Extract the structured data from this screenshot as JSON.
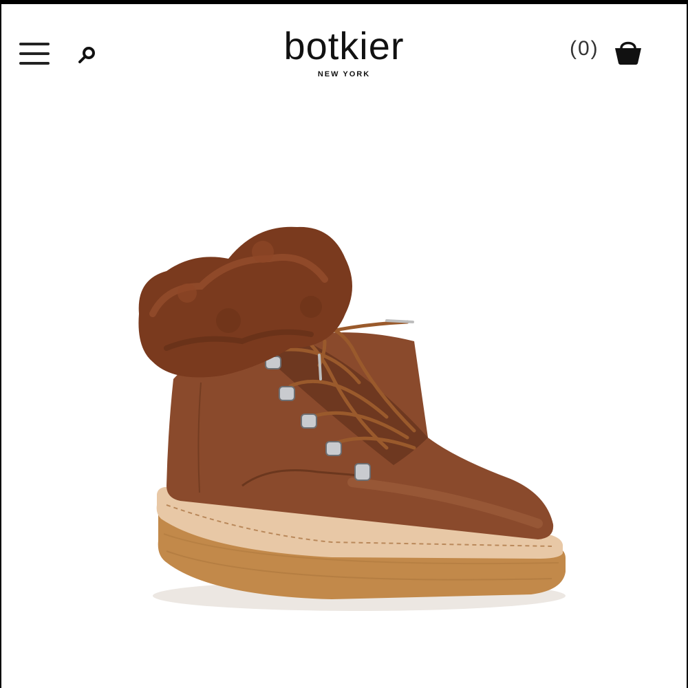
{
  "header": {
    "menu_icon": "hamburger-menu-icon",
    "search_icon": "search-icon",
    "logo": {
      "wordmark": "botkier",
      "subtitle": "NEW YORK"
    },
    "cart": {
      "count_text": "(0)",
      "icon": "shopping-bag-icon"
    }
  },
  "product": {
    "image_subject": "brown leather lace-up hiking boot with fur cuff and crepe sole",
    "colors": {
      "leather": "#8a4a2c",
      "fur": "#7a3a1e",
      "sole": "#c2894a",
      "welt": "#e8c8a6"
    }
  }
}
